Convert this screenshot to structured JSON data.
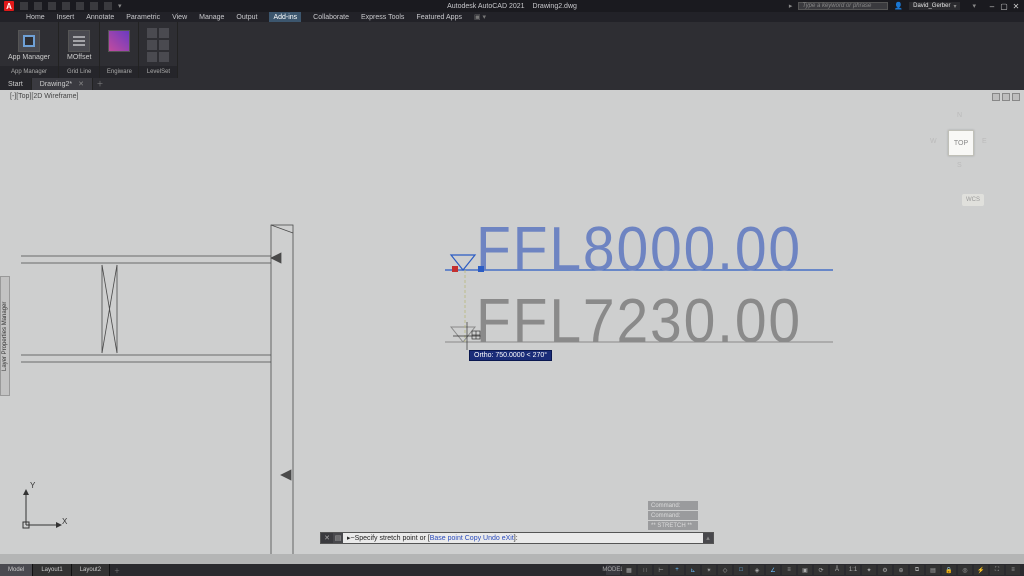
{
  "app": {
    "title": "Autodesk AutoCAD 2021",
    "document": "Drawing2.dwg"
  },
  "search": {
    "placeholder": "Type a keyword or phrase"
  },
  "user": {
    "name": "David_Gerber"
  },
  "menu": {
    "items": [
      "Home",
      "Insert",
      "Annotate",
      "Parametric",
      "View",
      "Manage",
      "Output",
      "Add-ins",
      "Collaborate",
      "Express Tools",
      "Featured Apps"
    ],
    "active_index": 7
  },
  "ribbon": {
    "panels": [
      {
        "label": "App Manager",
        "buttons": [
          "App Manager"
        ]
      },
      {
        "label": "Grid Line",
        "buttons": [
          "MOffset"
        ]
      },
      {
        "label": "Engiware",
        "buttons": []
      },
      {
        "label": "LevelSet",
        "buttons": []
      }
    ]
  },
  "doctabs": {
    "items": [
      {
        "label": "Start",
        "closable": false
      },
      {
        "label": "Drawing2*",
        "closable": true
      }
    ],
    "active_index": 1
  },
  "view": {
    "label": "[-][Top][2D Wireframe]"
  },
  "sidetab": {
    "label": "Layer Properties Manager"
  },
  "viewcube": {
    "face": "TOP",
    "n": "N",
    "s": "S",
    "e": "E",
    "w": "W",
    "wcs": "WCS"
  },
  "drawing": {
    "ffl_selected": "FFL8000.00",
    "ffl_ghost": "FFL7230.00",
    "ortho_tip": "Ortho: 750.0000 < 270°"
  },
  "ucs": {
    "x_label": "X",
    "y_label": "Y"
  },
  "command": {
    "history": [
      "Command:",
      "Command:",
      "** STRETCH **"
    ],
    "prompt_prefix": "▸~Specify stretch point or [",
    "options": [
      "Base point",
      "Copy",
      "Undo",
      "eXit"
    ],
    "prompt_suffix": "]:"
  },
  "layout_tabs": {
    "items": [
      "Model",
      "Layout1",
      "Layout2"
    ],
    "active_index": 0
  },
  "status": {
    "model_tag": "MODEL",
    "scale": "1:1",
    "icons": [
      "grid",
      "snap",
      "infer",
      "dyn",
      "ortho",
      "polar",
      "iso",
      "osnap",
      "3dosnap",
      "otrack",
      "lwt",
      "trans",
      "cyc",
      "ann",
      "auto",
      "ws",
      "mon",
      "units",
      "qp",
      "lock",
      "iso2",
      "hw",
      "clean",
      "cust"
    ]
  }
}
